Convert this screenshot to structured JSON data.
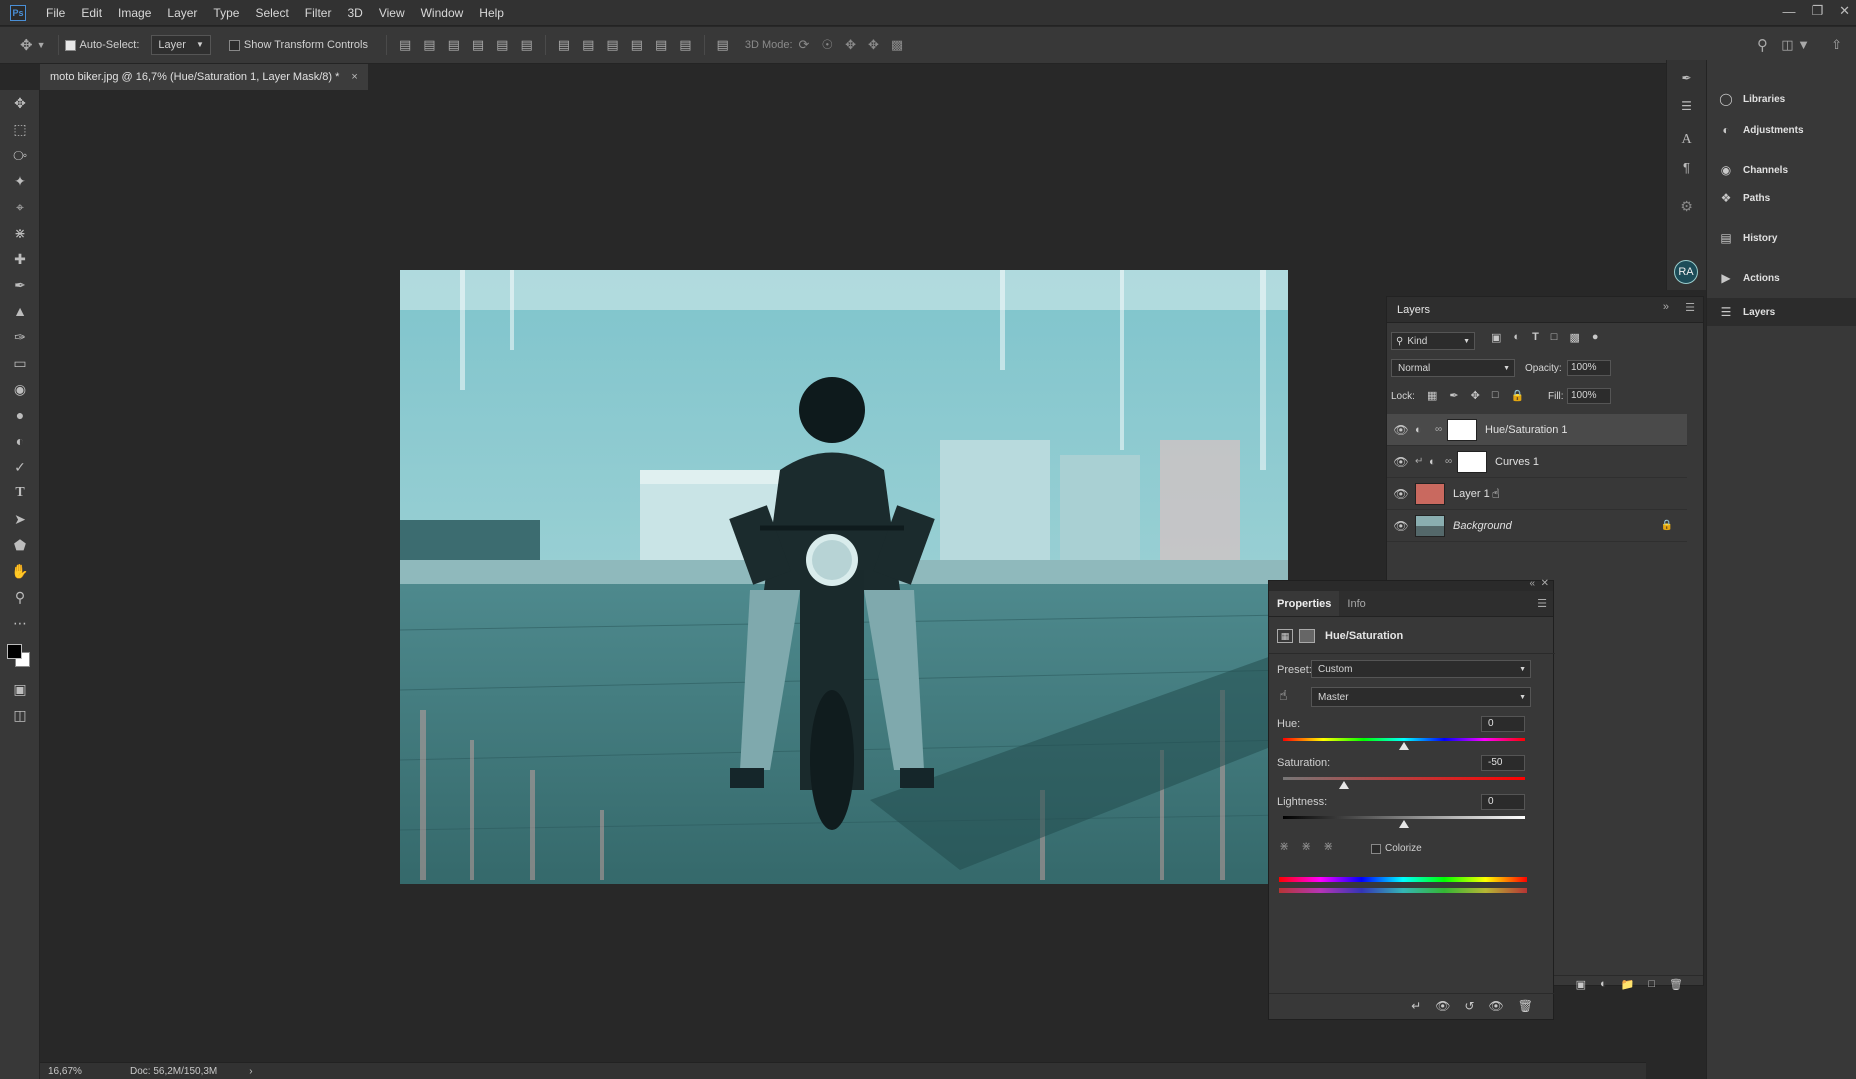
{
  "app": {
    "logo_text": "Ps"
  },
  "menu": [
    "File",
    "Edit",
    "Image",
    "Layer",
    "Type",
    "Select",
    "Filter",
    "3D",
    "View",
    "Window",
    "Help"
  ],
  "options": {
    "auto_select_label": "Auto-Select:",
    "auto_select_value": "Layer",
    "show_transform_label": "Show Transform Controls",
    "mode_3d_label": "3D Mode:"
  },
  "document": {
    "tab_title": "moto biker.jpg @ 16,7% (Hue/Saturation 1, Layer Mask/8) *",
    "close_glyph": "×"
  },
  "status": {
    "zoom": "16,67%",
    "doc": "Doc: 56,2M/150,3M"
  },
  "dock": {
    "items": [
      {
        "label": "Libraries",
        "icon": "libraries-icon"
      },
      {
        "label": "Adjustments",
        "icon": "adjustments-icon"
      },
      {
        "label": "Channels",
        "icon": "channels-icon"
      },
      {
        "label": "Paths",
        "icon": "paths-icon"
      },
      {
        "label": "History",
        "icon": "history-icon"
      },
      {
        "label": "Actions",
        "icon": "actions-icon"
      },
      {
        "label": "Layers",
        "icon": "layers-icon"
      }
    ],
    "avatar_initials": "RA"
  },
  "layers_panel": {
    "title": "Layers",
    "kind_label": "Kind",
    "blend_mode": "Normal",
    "opacity_label": "Opacity:",
    "opacity_value": "100%",
    "lock_label": "Lock:",
    "fill_label": "Fill:",
    "fill_value": "100%",
    "layers": [
      {
        "name": "Hue/Saturation 1",
        "selected": true
      },
      {
        "name": "Curves 1",
        "selected": false
      },
      {
        "name": "Layer 1",
        "selected": false
      },
      {
        "name": "Background",
        "selected": false
      }
    ]
  },
  "properties_panel": {
    "tabs": [
      "Properties",
      "Info"
    ],
    "title": "Hue/Saturation",
    "preset_label": "Preset:",
    "preset_value": "Custom",
    "channel_value": "Master",
    "hue_label": "Hue:",
    "hue_value": "0",
    "saturation_label": "Saturation:",
    "saturation_value": "-50",
    "lightness_label": "Lightness:",
    "lightness_value": "0",
    "colorize_label": "Colorize",
    "colorize_checked": false,
    "hue_fraction": 0.5,
    "saturation_fraction": 0.25,
    "lightness_fraction": 0.5
  }
}
